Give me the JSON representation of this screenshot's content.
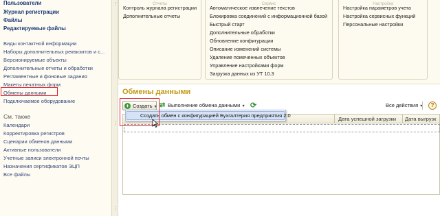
{
  "sidebar": {
    "bold_items": [
      "Пользователи",
      "Журнал регистрации",
      "Файлы",
      "Редактируемые файлы"
    ],
    "items": [
      "Виды контактной информации",
      "Наборы дополнительных реквизитов и с...",
      "Версионируемые объекты",
      "Дополнительные отчеты и обработки",
      "Регламентные и фоновые задания",
      "Макеты печатных форм",
      "Обмены данными",
      "Подключаемое оборудование"
    ],
    "see_also_heading": "См. также",
    "see_also_items": [
      "Календари",
      "Корректировка регистров",
      "Сценарии обменов данными",
      "Активные пользователи",
      "Учетные записи электронной почты",
      "Назначения сертификатов ЭЦП",
      "Все файлы"
    ]
  },
  "top_panel": {
    "col1": {
      "label": "Отчеты",
      "items": [
        "Контроль журнала регистрации",
        "Дополнительные отчеты"
      ]
    },
    "col2": {
      "label": "Сервис",
      "items": [
        "Автоматическое извлечение текстов",
        "Блокировка соединений с информационной базой",
        "Быстрый старт",
        "Дополнительные обработки",
        "Обновление конфигурации",
        "Описание изменений системы",
        "Удаление помеченных объектов",
        "Управление настройками форм",
        "Загрузка данных из УТ 10.3"
      ]
    },
    "col3": {
      "label": "Настройка",
      "items": [
        "Настройка параметров учета",
        "Настройка сервисных функций",
        "Персональные настройки"
      ]
    }
  },
  "main": {
    "title": "Обмены данными",
    "toolbar": {
      "create_label": "Создать",
      "exchange_label": "Выполнение обмена данными",
      "all_actions_label": "Все действия",
      "help": "?"
    },
    "dropdown_item": "Создать обмен с конфигурацией Бухгалтерия предприятия 2.0",
    "columns": [
      "Дата успешной загрузки",
      "Дата выгрузк"
    ]
  },
  "colors": {
    "title": "#c49a12",
    "highlight_box": "#e0202a",
    "dropdown_selection": "#d6e3f7"
  },
  "icons": [
    "plus-icon",
    "sync-icon",
    "refresh-icon",
    "help-icon",
    "cursor-icon"
  ]
}
